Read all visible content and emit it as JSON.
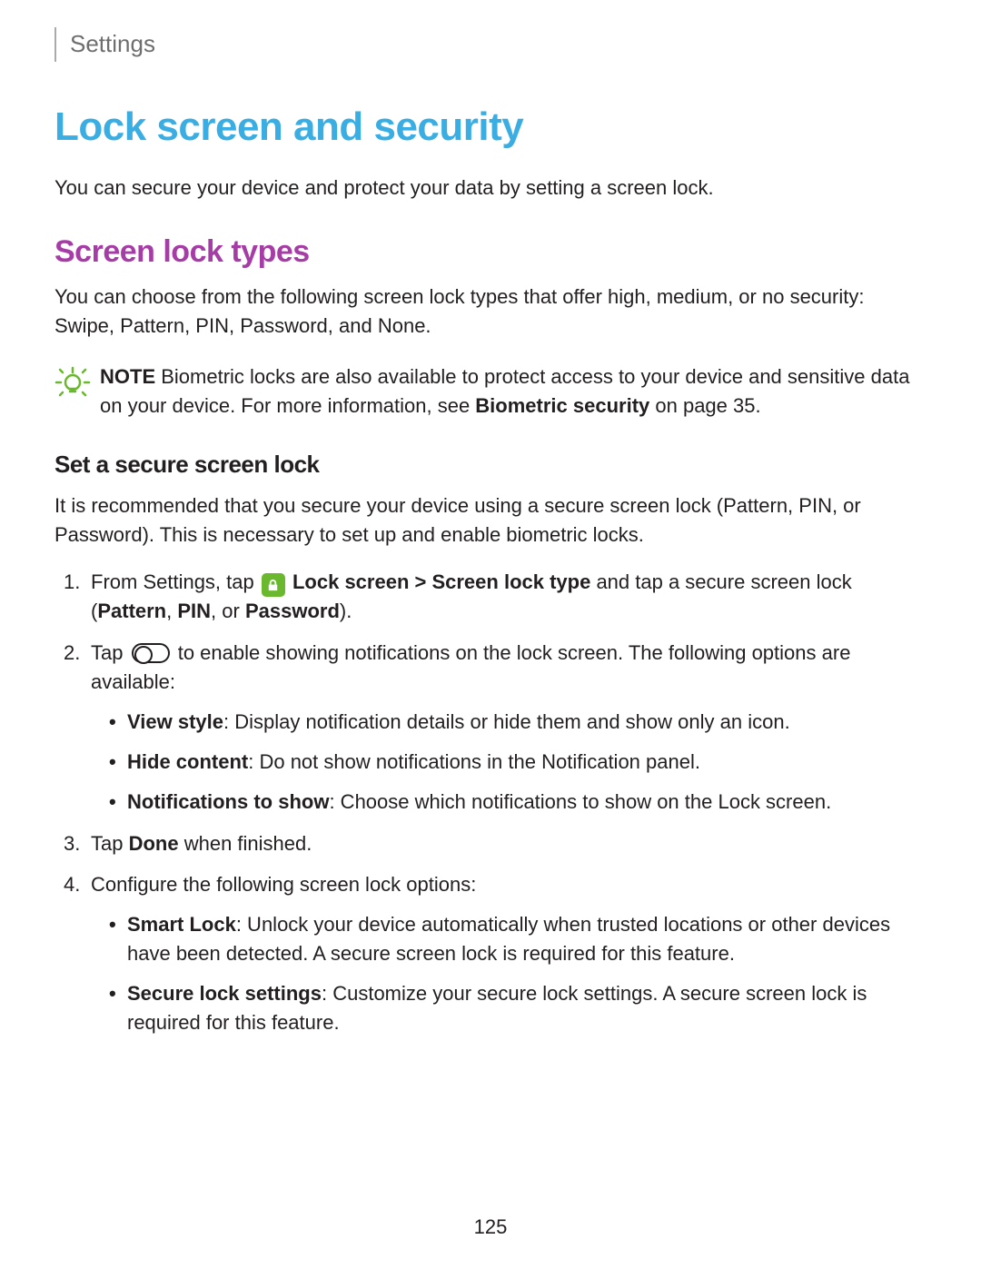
{
  "breadcrumb": "Settings",
  "page_title": "Lock screen and security",
  "intro": "You can secure your device and protect your data by setting a screen lock.",
  "section_title": "Screen lock types",
  "section_desc": "You can choose from the following screen lock types that offer high, medium, or no security: Swipe, Pattern, PIN, Password, and None.",
  "note": {
    "label": "NOTE",
    "text_before": " Biometric locks are also available to protect access to your device and sensitive data on your device. For more information, see ",
    "link": "Biometric security",
    "text_after": " on page 35."
  },
  "subsection_title": "Set a secure screen lock",
  "subsection_desc": "It is recommended that you secure your device using a secure screen lock (Pattern, PIN, or Password). This is necessary to set up and enable biometric locks.",
  "steps": {
    "s1": {
      "pre": "From Settings, tap ",
      "bold1": "Lock screen > Screen lock type",
      "mid": " and tap a secure screen lock (",
      "bold2": "Pattern",
      "c1": ", ",
      "bold3": "PIN",
      "c2": ", or ",
      "bold4": "Password",
      "end": ")."
    },
    "s2": {
      "pre": "Tap ",
      "post": " to enable showing notifications on the lock screen. The following options are available:",
      "bullets": [
        {
          "label": "View style",
          "text": ": Display notification details or hide them and show only an icon."
        },
        {
          "label": "Hide content",
          "text": ": Do not show notifications in the Notification panel."
        },
        {
          "label": "Notifications to show",
          "text": ": Choose which notifications to show on the Lock screen."
        }
      ]
    },
    "s3": {
      "pre": "Tap ",
      "bold": "Done",
      "post": " when finished."
    },
    "s4": {
      "text": "Configure the following screen lock options:",
      "bullets": [
        {
          "label": "Smart Lock",
          "text": ": Unlock your device automatically when trusted locations or other devices have been detected. A secure screen lock is required for this feature."
        },
        {
          "label": "Secure lock settings",
          "text": ": Customize your secure lock settings. A secure screen lock is required for this feature."
        }
      ]
    }
  },
  "page_number": "125"
}
